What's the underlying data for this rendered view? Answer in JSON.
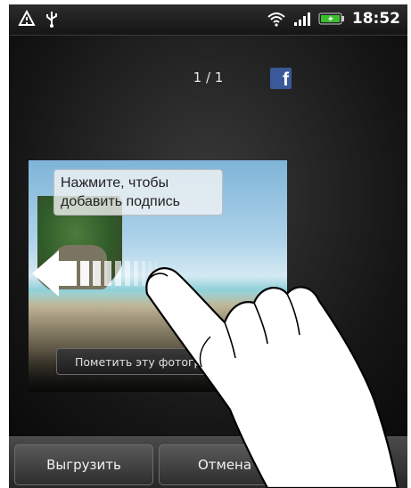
{
  "status_bar": {
    "time": "18:52",
    "left_icons": [
      "alert-triangle-icon",
      "usb-icon"
    ],
    "right_icons": [
      "wifi-icon",
      "signal-icon",
      "battery-icon"
    ]
  },
  "viewer": {
    "counter": "1 / 1",
    "share_icon": "facebook-icon",
    "caption_placeholder": "Нажмите, чтобы добавить подпись",
    "tag_button_label": "Пометить эту фотограф"
  },
  "bottom_bar": {
    "upload_label": "Выгрузить",
    "cancel_label": "Отмена"
  },
  "colors": {
    "facebook": "#3b5998",
    "battery": "#3cbf2f"
  }
}
